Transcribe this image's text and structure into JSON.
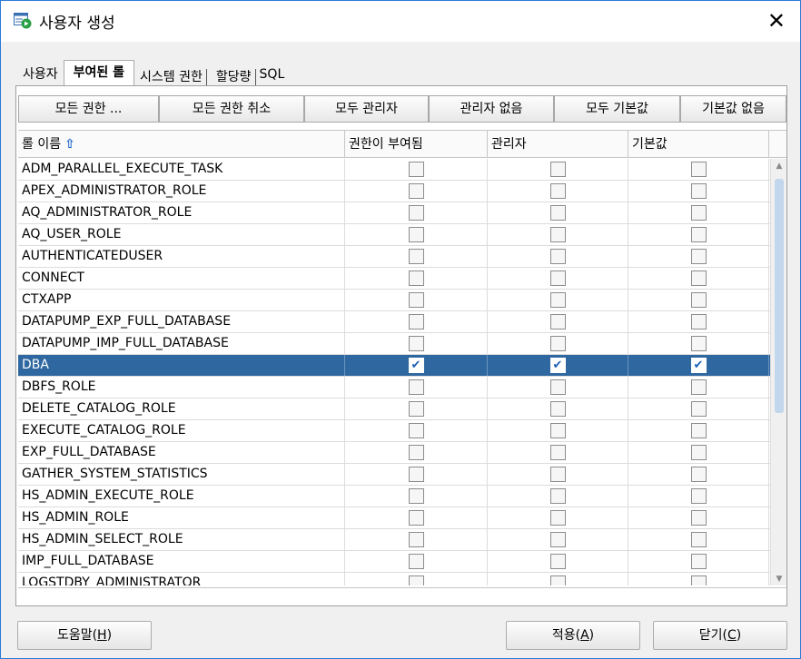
{
  "window": {
    "title": "사용자 생성",
    "close_icon": "close-icon"
  },
  "tabs": [
    {
      "label": "사용자",
      "active": false
    },
    {
      "label": "부여된 롤",
      "active": true
    },
    {
      "label": "시스템 권한",
      "active": false
    },
    {
      "label": "할당량",
      "active": false
    },
    {
      "label": "SQL",
      "active": false
    }
  ],
  "toolbar": {
    "grant_all": "모든 권한 ...",
    "revoke_all": "모든 권한 취소",
    "all_admin": "모두 관리자",
    "no_admin": "관리자 없음",
    "all_default": "모두 기본값",
    "no_default": "기본값 없음"
  },
  "table": {
    "columns": [
      "롤 이름",
      "권한이 부여됨",
      "관리자",
      "기본값"
    ],
    "sort_icon": "sort-ascending-arrow-icon",
    "rows": [
      {
        "name": "ADM_PARALLEL_EXECUTE_TASK",
        "granted": false,
        "admin": false,
        "default": false
      },
      {
        "name": "APEX_ADMINISTRATOR_ROLE",
        "granted": false,
        "admin": false,
        "default": false
      },
      {
        "name": "AQ_ADMINISTRATOR_ROLE",
        "granted": false,
        "admin": false,
        "default": false
      },
      {
        "name": "AQ_USER_ROLE",
        "granted": false,
        "admin": false,
        "default": false
      },
      {
        "name": "AUTHENTICATEDUSER",
        "granted": false,
        "admin": false,
        "default": false
      },
      {
        "name": "CONNECT",
        "granted": false,
        "admin": false,
        "default": false
      },
      {
        "name": "CTXAPP",
        "granted": false,
        "admin": false,
        "default": false
      },
      {
        "name": "DATAPUMP_EXP_FULL_DATABASE",
        "granted": false,
        "admin": false,
        "default": false
      },
      {
        "name": "DATAPUMP_IMP_FULL_DATABASE",
        "granted": false,
        "admin": false,
        "default": false
      },
      {
        "name": "DBA",
        "granted": true,
        "admin": true,
        "default": true,
        "selected": true
      },
      {
        "name": "DBFS_ROLE",
        "granted": false,
        "admin": false,
        "default": false
      },
      {
        "name": "DELETE_CATALOG_ROLE",
        "granted": false,
        "admin": false,
        "default": false
      },
      {
        "name": "EXECUTE_CATALOG_ROLE",
        "granted": false,
        "admin": false,
        "default": false
      },
      {
        "name": "EXP_FULL_DATABASE",
        "granted": false,
        "admin": false,
        "default": false
      },
      {
        "name": "GATHER_SYSTEM_STATISTICS",
        "granted": false,
        "admin": false,
        "default": false
      },
      {
        "name": "HS_ADMIN_EXECUTE_ROLE",
        "granted": false,
        "admin": false,
        "default": false
      },
      {
        "name": "HS_ADMIN_ROLE",
        "granted": false,
        "admin": false,
        "default": false
      },
      {
        "name": "HS_ADMIN_SELECT_ROLE",
        "granted": false,
        "admin": false,
        "default": false
      },
      {
        "name": "IMP_FULL_DATABASE",
        "granted": false,
        "admin": false,
        "default": false
      },
      {
        "name": "LOGSTDBY_ADMINISTRATOR",
        "granted": false,
        "admin": false,
        "default": false
      }
    ]
  },
  "footer": {
    "help": "도움말(",
    "help_key": "H",
    "apply": "적용(",
    "apply_key": "A",
    "close": "닫기(",
    "close_key": "C",
    "paren": ")"
  },
  "colors": {
    "selection": "#2f68a1",
    "accent": "#1d64c8",
    "default_check": "#fff59a"
  }
}
